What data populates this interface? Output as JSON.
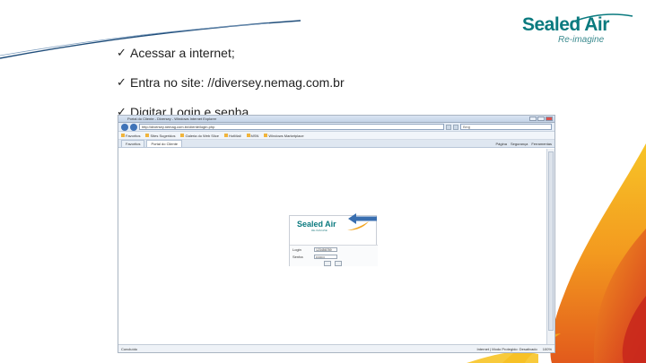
{
  "brand": {
    "name": "Sealed Air",
    "tagline": "Re-imagine"
  },
  "bullets": [
    "Acessar a internet;",
    "Entra no site: //diversey.nemag.com.br",
    "Digitar Login e senha"
  ],
  "check_glyph": "ü",
  "browser": {
    "window_title": "Portal do Cliente - Diversey - Windows Internet Explorer",
    "address": "http://diversey.nemag.com.br/cliente/login.php",
    "search_placeholder": "Bing",
    "favorites": [
      "Favoritos",
      "Sites Sugeridos",
      "Galeria do Web Slice",
      "HotMail",
      "MSN",
      "Windows Marketplace"
    ],
    "tabs": [
      "Favoritos",
      "Portal do Cliente"
    ],
    "commands": [
      "Página",
      "Segurança",
      "Ferramentas"
    ],
    "status_left": "Concluído",
    "status_right": [
      "Internet | Modo Protegido: Desativado",
      "100%"
    ],
    "login": {
      "logo": "Sealed Air",
      "logo_sub": "RE-IMAGINE",
      "fields": [
        {
          "label": "Login",
          "value": "123456789"
        },
        {
          "label": "Senha",
          "value": "••••••••"
        }
      ]
    }
  },
  "colors": {
    "brand_teal": "#0a7a7f",
    "flame_yellow": "#f7c427",
    "flame_orange": "#ee7d1a",
    "flame_red": "#d3301f",
    "swoosh_blue": "#1f4d7a",
    "arrow_blue": "#3a6fb0"
  }
}
